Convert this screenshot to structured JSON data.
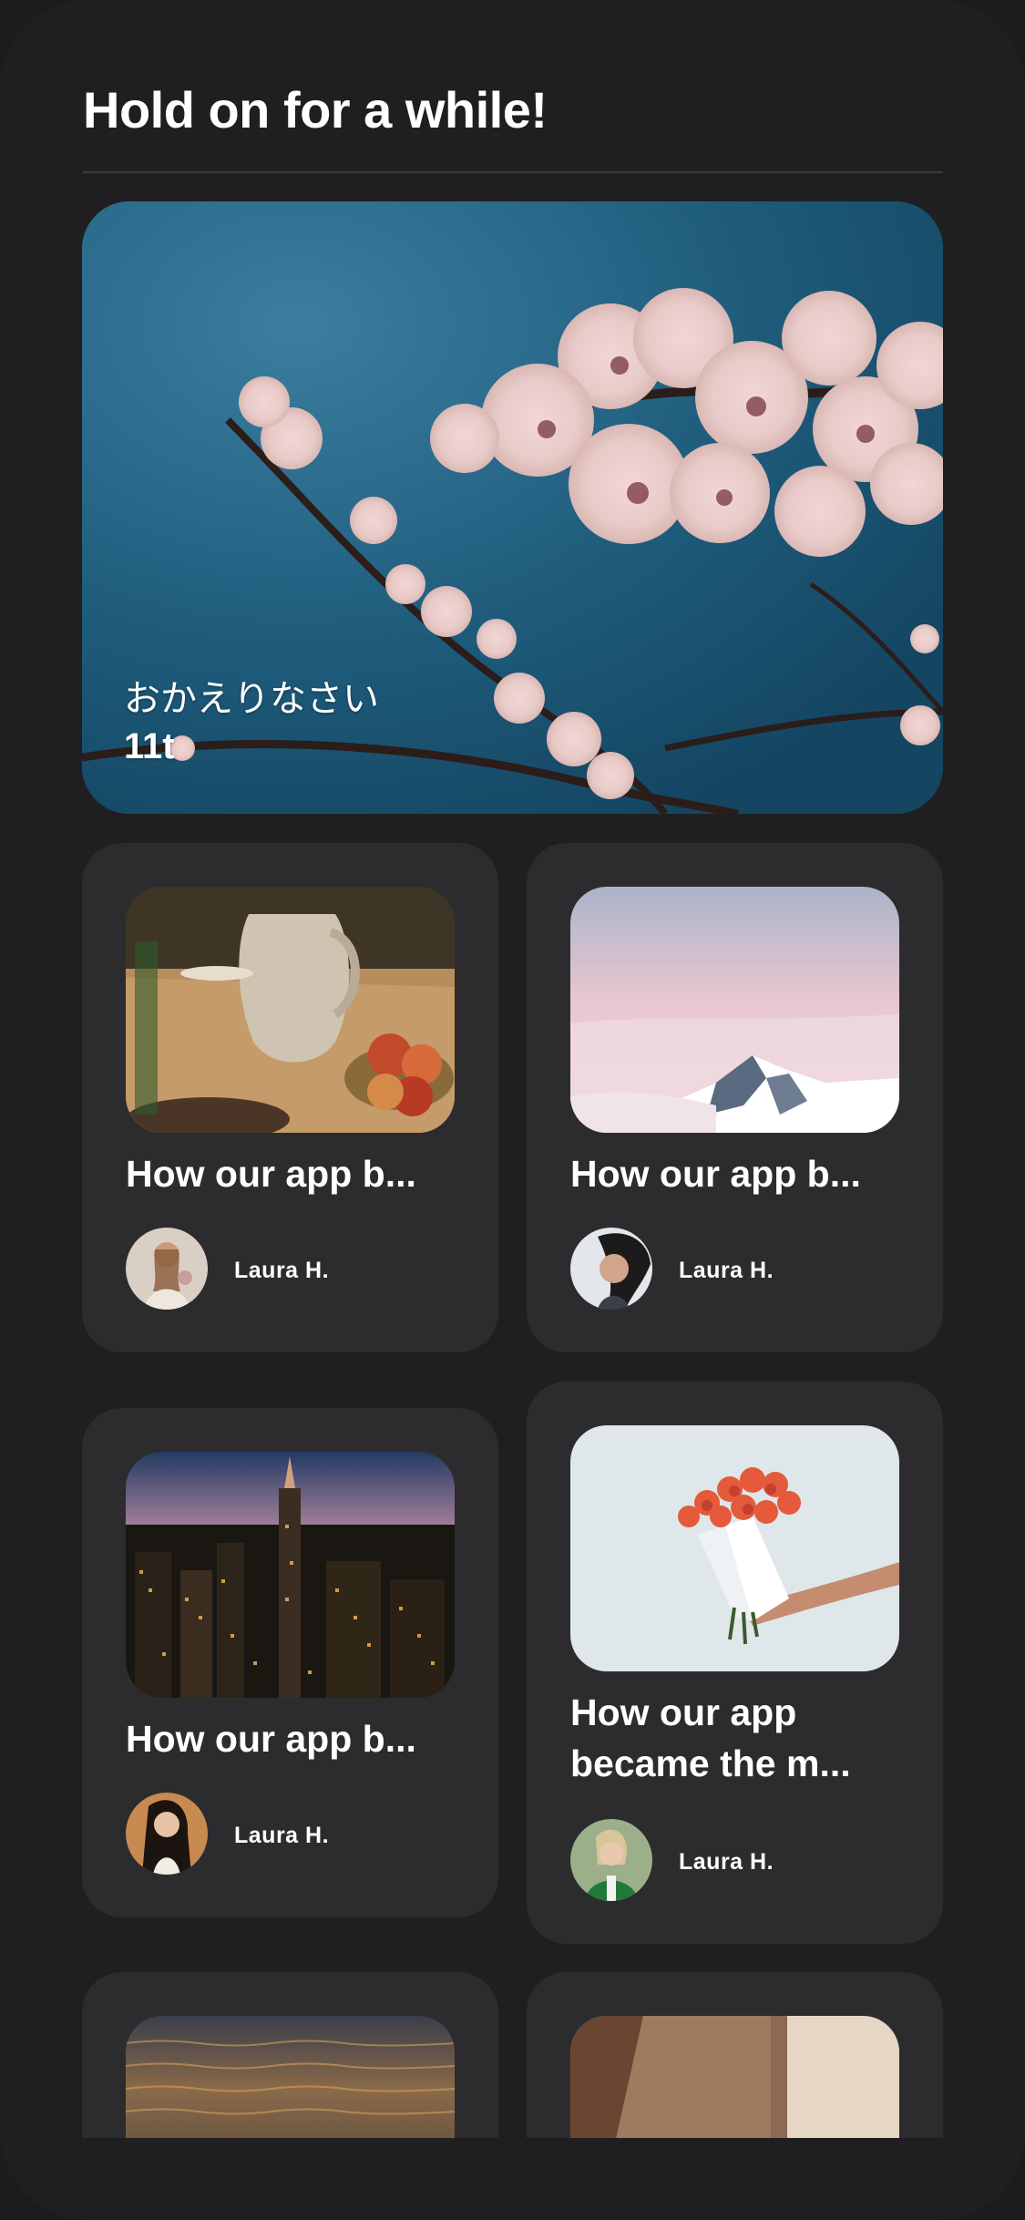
{
  "header": {
    "title": "Hold on for a while!"
  },
  "hero": {
    "caption_line1": "おかえりなさい",
    "caption_line2": "11t",
    "image": "cherry-blossom-photo"
  },
  "cards": [
    {
      "title": "How our app b...",
      "author": "Laura H.",
      "image": "pottery-vase-apples-photo",
      "avatar": "woman-avatar-1"
    },
    {
      "title": "How our app b...",
      "author": "Laura H.",
      "image": "snowy-mountain-photo",
      "avatar": "woman-avatar-2"
    },
    {
      "title": "How our app b...",
      "author": "Laura H.",
      "image": "city-night-skyline-photo",
      "avatar": "woman-avatar-3"
    },
    {
      "title": "How our app became the m...",
      "author": "Laura H.",
      "image": "flower-bouquet-photo",
      "avatar": "woman-avatar-4"
    },
    {
      "title": "",
      "author": "",
      "image": "sunset-ocean-photo",
      "avatar": ""
    },
    {
      "title": "",
      "author": "",
      "image": "beige-architecture-photo",
      "avatar": ""
    }
  ],
  "colors": {
    "background": "#1f1f21",
    "card": "#2c2c2e",
    "text": "#ffffff",
    "divider": "#3a3a3d"
  }
}
